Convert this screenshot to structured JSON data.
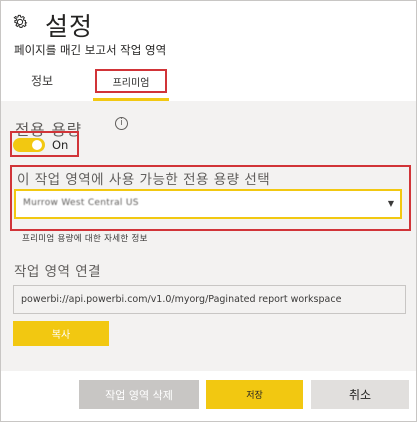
{
  "header": {
    "title": "설정",
    "subtitle": "페이지를 매긴 보고서 작업 영역",
    "gear_icon": "gear-icon"
  },
  "tabs": [
    {
      "label": "정보",
      "active": false
    },
    {
      "label": "프리미엄",
      "active": true
    }
  ],
  "premium": {
    "section_label": "전용 용량",
    "info_icon": "info-icon",
    "toggle": {
      "label": "On",
      "checked": true
    },
    "capacity_label": "이 작업 영역에 사용 가능한 전용 용량 선택",
    "capacity_value": "Murrow West Central US",
    "more_info_link": "프리미엄 용량에 대한 자세한 정보",
    "connection_label": "작업 영역 연결",
    "connection_url": "powerbi://api.powerbi.com/v1.0/myorg/Paginated report workspace",
    "copy_button": "복사"
  },
  "footer": {
    "delete_button": "작업 영역 삭제",
    "save_button": "저장",
    "cancel_button": "취소"
  },
  "colors": {
    "accent": "#f2c811",
    "highlight_border": "#d13438",
    "panel_bg": "#f3f2f1"
  }
}
